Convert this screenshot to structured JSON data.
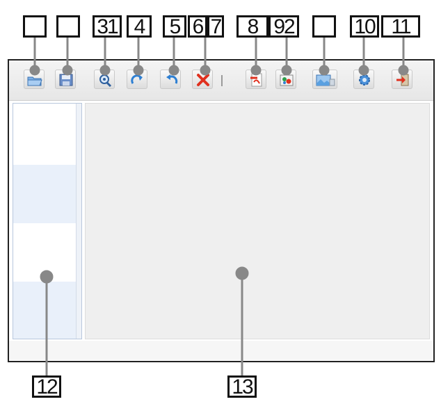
{
  "callouts": {
    "c1": "",
    "c2": "",
    "c3": "31",
    "c4": "4",
    "c5": "5",
    "c6": "6",
    "c7": "7",
    "c8": "8",
    "c9": "92",
    "c10": "",
    "c11": "10",
    "c12": "11",
    "c13": "12",
    "c14": "13"
  },
  "toolbar_icons": [
    "open-folder-icon",
    "save-icon",
    "zoom-icon",
    "redo-icon",
    "undo-icon",
    "delete-icon",
    "pdf-export-icon",
    "color-palette-icon",
    "image-export-icon",
    "settings-gear-icon",
    "exit-icon"
  ],
  "colors": {
    "window_border": "#222222",
    "panel_border": "#b8c7dd",
    "panel_stripe": "#e9f0fa",
    "main_area": "#efefef",
    "toolbar": "#e6e6e6",
    "accent_blue": "#2d7fd3",
    "accent_red": "#e0301e"
  }
}
